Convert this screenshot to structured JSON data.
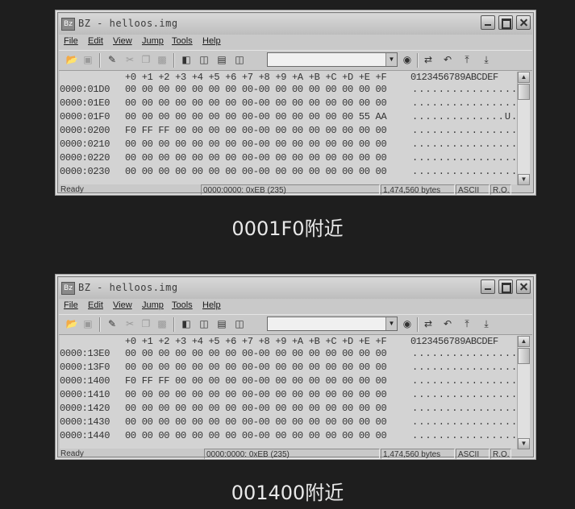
{
  "windows": [
    {
      "title": "BZ - helloos.img",
      "app_icon": "Bz",
      "menu": [
        "File",
        "Edit",
        "View",
        "Jump",
        "Tools",
        "Help"
      ],
      "hex_header": "+0 +1 +2 +3 +4 +5 +6 +7 +8 +9 +A +B +C +D +E +F",
      "ascii_header": "0123456789ABCDEF",
      "rows": [
        {
          "addr": "0000:01D0",
          "bytes": "00 00 00 00 00 00 00 00-00 00 00 00 00 00 00 00",
          "ascii": "................"
        },
        {
          "addr": "0000:01E0",
          "bytes": "00 00 00 00 00 00 00 00-00 00 00 00 00 00 00 00",
          "ascii": "................"
        },
        {
          "addr": "0000:01F0",
          "bytes": "00 00 00 00 00 00 00 00-00 00 00 00 00 00 55 AA",
          "ascii": "..............U."
        },
        {
          "addr": "0000:0200",
          "bytes": "F0 FF FF 00 00 00 00 00-00 00 00 00 00 00 00 00",
          "ascii": "................"
        },
        {
          "addr": "0000:0210",
          "bytes": "00 00 00 00 00 00 00 00-00 00 00 00 00 00 00 00",
          "ascii": "................"
        },
        {
          "addr": "0000:0220",
          "bytes": "00 00 00 00 00 00 00 00-00 00 00 00 00 00 00 00",
          "ascii": "................"
        },
        {
          "addr": "0000:0230",
          "bytes": "00 00 00 00 00 00 00 00-00 00 00 00 00 00 00 00",
          "ascii": "................"
        }
      ],
      "status": {
        "ready": "Ready",
        "position": "0000:0000: 0xEB (235)",
        "size": "1,474,560 bytes",
        "encoding": "ASCII",
        "mode": "R.O."
      },
      "caption": "0001F0附近"
    },
    {
      "title": "BZ - helloos.img",
      "app_icon": "Bz",
      "menu": [
        "File",
        "Edit",
        "View",
        "Jump",
        "Tools",
        "Help"
      ],
      "hex_header": "+0 +1 +2 +3 +4 +5 +6 +7 +8 +9 +A +B +C +D +E +F",
      "ascii_header": "0123456789ABCDEF",
      "rows": [
        {
          "addr": "0000:13E0",
          "bytes": "00 00 00 00 00 00 00 00-00 00 00 00 00 00 00 00",
          "ascii": "................"
        },
        {
          "addr": "0000:13F0",
          "bytes": "00 00 00 00 00 00 00 00-00 00 00 00 00 00 00 00",
          "ascii": "................"
        },
        {
          "addr": "0000:1400",
          "bytes": "F0 FF FF 00 00 00 00 00-00 00 00 00 00 00 00 00",
          "ascii": "................"
        },
        {
          "addr": "0000:1410",
          "bytes": "00 00 00 00 00 00 00 00-00 00 00 00 00 00 00 00",
          "ascii": "................"
        },
        {
          "addr": "0000:1420",
          "bytes": "00 00 00 00 00 00 00 00-00 00 00 00 00 00 00 00",
          "ascii": "................"
        },
        {
          "addr": "0000:1430",
          "bytes": "00 00 00 00 00 00 00 00-00 00 00 00 00 00 00 00",
          "ascii": "................"
        },
        {
          "addr": "0000:1440",
          "bytes": "00 00 00 00 00 00 00 00-00 00 00 00 00 00 00 00",
          "ascii": "................"
        }
      ],
      "status": {
        "ready": "Ready",
        "position": "0000:0000: 0xEB (235)",
        "size": "1,474,560 bytes",
        "encoding": "ASCII",
        "mode": "R.O."
      },
      "caption": "001400附近"
    }
  ],
  "icons": [
    "open-icon",
    "save-icon",
    "cut-mode-icon",
    "cut-icon",
    "copy-icon",
    "paste-icon",
    "view-single-icon",
    "view-split-vertical-icon",
    "view-split-horizontal-icon",
    "view-compare-icon",
    "binoculars-icon",
    "compare-icon",
    "undo-icon",
    "jump-top-icon",
    "jump-bottom-icon"
  ]
}
